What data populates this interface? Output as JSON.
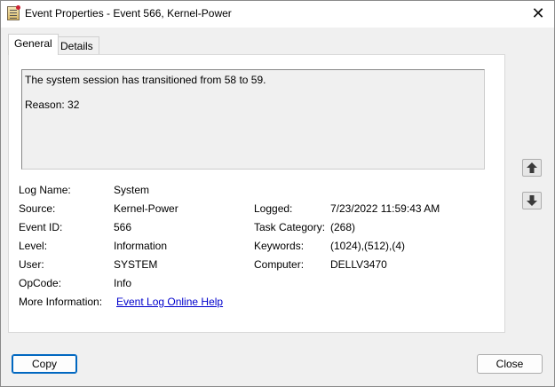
{
  "window": {
    "title": "Event Properties - Event 566, Kernel-Power",
    "close_glyph": "✕"
  },
  "tabs": [
    {
      "label": "General",
      "selected": true
    },
    {
      "label": "Details",
      "selected": false
    }
  ],
  "description": "The system session has transitioned from 58 to 59.\n\nReason: 32",
  "fields": {
    "log_name": {
      "label": "Log Name:",
      "value": "System"
    },
    "source": {
      "label": "Source:",
      "value": "Kernel-Power"
    },
    "event_id": {
      "label": "Event ID:",
      "value": "566"
    },
    "level": {
      "label": "Level:",
      "value": "Information"
    },
    "user": {
      "label": "User:",
      "value": "SYSTEM"
    },
    "opcode": {
      "label": "OpCode:",
      "value": "Info"
    },
    "more_info": {
      "label": "More Information:",
      "value": "Event Log Online Help"
    },
    "logged": {
      "label": "Logged:",
      "value": "7/23/2022 11:59:43 AM"
    },
    "task_category": {
      "label": "Task Category:",
      "value": "(268)"
    },
    "keywords": {
      "label": "Keywords:",
      "value": "(1024),(512),(4)"
    },
    "computer": {
      "label": "Computer:",
      "value": "DELLV3470"
    }
  },
  "nav": {
    "up_icon": "arrow-up-icon",
    "down_icon": "arrow-down-icon"
  },
  "buttons": {
    "copy": "Copy",
    "close": "Close"
  }
}
